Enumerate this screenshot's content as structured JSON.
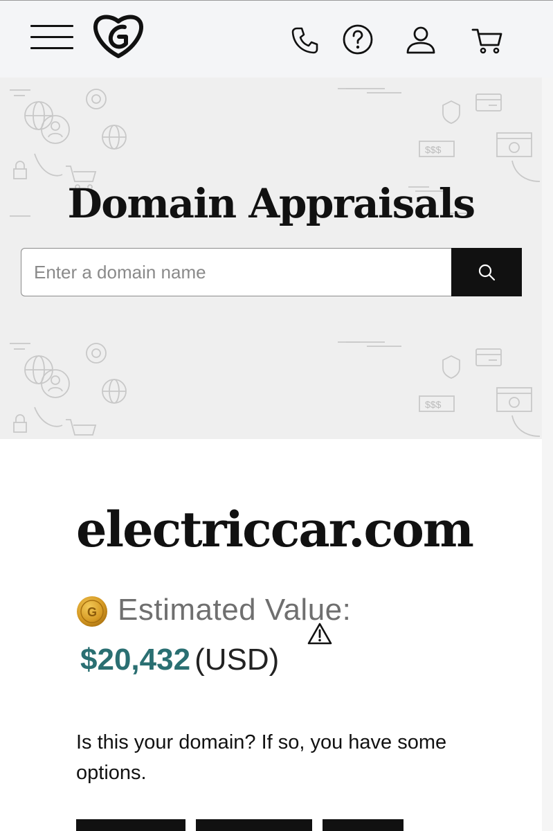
{
  "header": {
    "menu_icon": "hamburger-menu-icon",
    "logo_icon": "godaddy-logo-icon",
    "phone_icon": "phone-icon",
    "help_icon": "help-question-icon",
    "account_icon": "user-account-icon",
    "cart_icon": "shopping-cart-icon"
  },
  "hero": {
    "title": "Domain Appraisals",
    "search": {
      "placeholder": "Enter a domain name",
      "value": "",
      "button_icon": "search-icon"
    },
    "pattern_texts": [
      "$$$",
      "$$$"
    ]
  },
  "result": {
    "domain": "electriccar.com",
    "coin_icon": "gold-coin-g-icon",
    "estimated_label": "Estimated Value:",
    "warning_icon": "warning-triangle-icon",
    "price": "$20,432",
    "currency": "(USD)",
    "description": "Is this your domain? If so, you have some options."
  },
  "colors": {
    "header_bg": "#f4f5f7",
    "hero_bg": "#efefef",
    "price": "#2a6f72",
    "button_bg": "#111111"
  }
}
